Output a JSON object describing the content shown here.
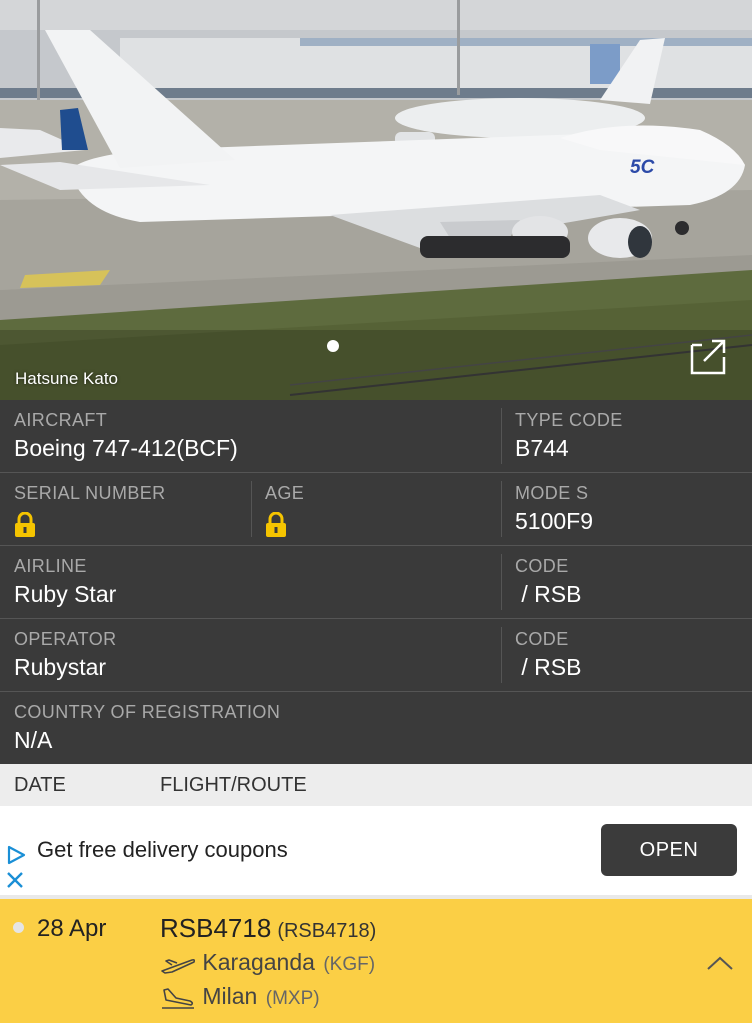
{
  "photo": {
    "credit": "Hatsune Kato",
    "tail_text": "5C"
  },
  "aircraft": {
    "aircraft_label": "AIRCRAFT",
    "aircraft_value": "Boeing 747-412(BCF)",
    "type_code_label": "TYPE CODE",
    "type_code_value": "B744",
    "serial_label": "SERIAL NUMBER",
    "age_label": "AGE",
    "mode_s_label": "MODE S",
    "mode_s_value": "5100F9",
    "airline_label": "AIRLINE",
    "airline_value": "Ruby Star",
    "airline_code_label": "CODE",
    "airline_code_value": " / RSB",
    "operator_label": "OPERATOR",
    "operator_value": "Rubystar",
    "operator_code_label": "CODE",
    "operator_code_value": " / RSB",
    "country_label": "COUNTRY OF REGISTRATION",
    "country_value": "N/A"
  },
  "table_header": {
    "date": "DATE",
    "flight_route": "FLIGHT/ROUTE"
  },
  "ad": {
    "text": "Get free delivery coupons",
    "button": "OPEN"
  },
  "flight": {
    "date": "28 Apr",
    "number": "RSB4718",
    "callsign": "(RSB4718)",
    "from_city": "Karaganda",
    "from_code": "(KGF)",
    "to_city": "Milan",
    "to_code": "(MXP)"
  },
  "colors": {
    "panel_bg": "#3a3a3a",
    "label_gray": "#a9a9a9",
    "lock_yellow": "#f5c400",
    "flight_row_bg": "#fbcf45",
    "ad_button_bg": "#3b3b3b",
    "tail_blue": "#2c4aa8"
  },
  "icons": [
    "expand-icon",
    "lock-icon",
    "takeoff-icon",
    "landing-icon",
    "chevron-up-icon",
    "ad-play-icon",
    "ad-close-icon"
  ]
}
